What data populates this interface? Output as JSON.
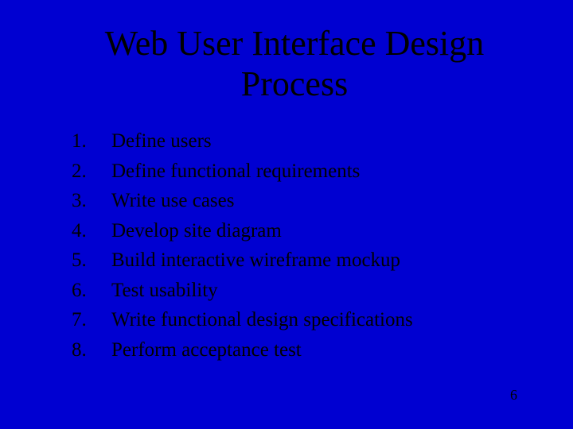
{
  "title": "Web User Interface Design Process",
  "items": [
    {
      "n": "1.",
      "text": "Define users"
    },
    {
      "n": "2.",
      "text": "Define functional requirements"
    },
    {
      "n": "3.",
      "text": "Write use cases"
    },
    {
      "n": "4.",
      "text": "Develop site diagram"
    },
    {
      "n": "5.",
      "text": "Build interactive wireframe mockup"
    },
    {
      "n": "6.",
      "text": "Test usability"
    },
    {
      "n": "7.",
      "text": "Write functional design specifications"
    },
    {
      "n": "8.",
      "text": "Perform acceptance test"
    }
  ],
  "page_number": "6"
}
